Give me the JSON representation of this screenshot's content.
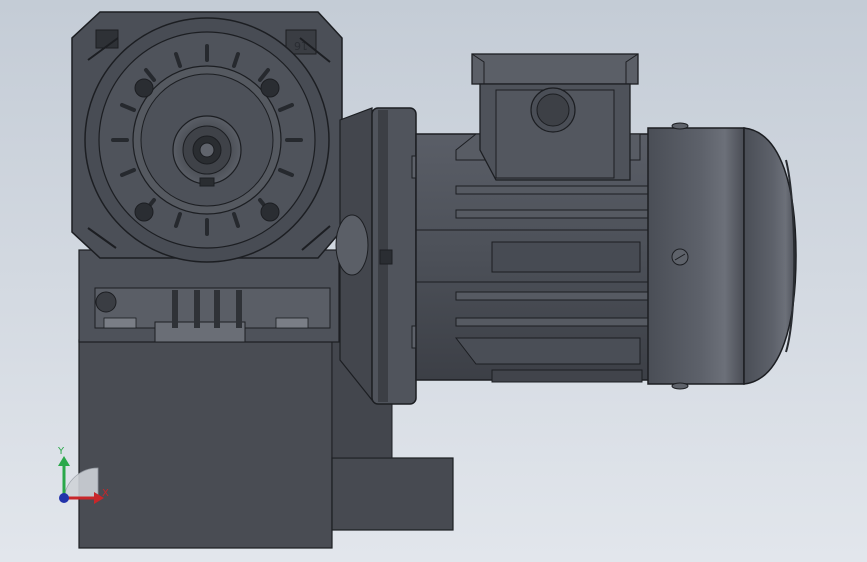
{
  "viewport": {
    "background_top": "#c4ccd6",
    "background_bottom": "#e2e6ec"
  },
  "model": {
    "gearbox_emboss": "16",
    "body_color": "#4b4f57",
    "edge_color": "#1c1e22"
  },
  "triad": {
    "x_label": "X",
    "y_label": "Y",
    "x_color": "#c8262a",
    "y_color": "#2aa84a",
    "z_color": "#2233aa"
  }
}
